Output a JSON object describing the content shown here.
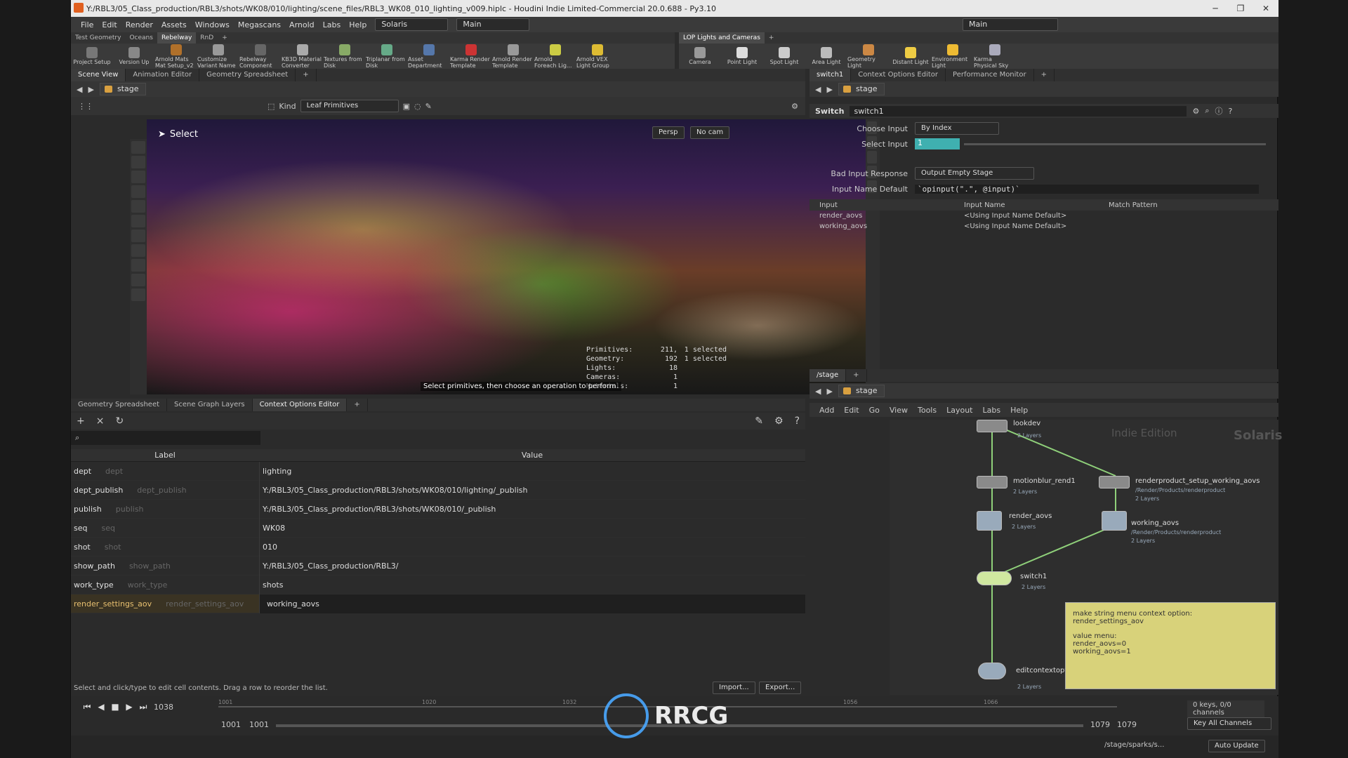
{
  "window": {
    "title": "Y:/RBL3/05_Class_production/RBL3/shots/WK08/010/lighting/scene_files/RBL3_WK08_010_lighting_v009.hiplc - Houdini Indie Limited-Commercial 20.0.688 - Py3.10",
    "minimize": "─",
    "maximize": "❐",
    "close": "✕"
  },
  "menu": [
    "File",
    "Edit",
    "Render",
    "Assets",
    "Windows",
    "Megascans",
    "Arnold",
    "Labs",
    "Help"
  ],
  "desktop": "Solaris",
  "workspace": "Main",
  "workspace_right": "Main",
  "shelf_tabs_left": [
    "Test Geometry",
    "Oceans",
    "Rebelway",
    "RnD"
  ],
  "shelf_tools_left": [
    "Project Setup",
    "Version Up",
    "Arnold Mats Mat Setup_v2",
    "Customize Variant Name",
    "Rebelway Component",
    "KB3D Material Converter",
    "Textures from Disk",
    "Triplanar from Disk",
    "Asset Department",
    "Karma Render Template",
    "Arnold Render Template",
    "Arnold Foreach Lig...",
    "Arnold VEX Light Group"
  ],
  "shelf_tabs_right": [
    "LOP Lights and Cameras"
  ],
  "shelf_tools_right": [
    "Camera",
    "Point Light",
    "Spot Light",
    "Area Light",
    "Geometry Light",
    "Distant Light",
    "Environment Light",
    "Karma Physical Sky"
  ],
  "viewer_tabs": [
    "Scene View",
    "Animation Editor",
    "Geometry Spreadsheet"
  ],
  "stage_path": "stage",
  "viewer": {
    "kind_label": "Kind",
    "kind_value": "Leaf Primitives",
    "select_label": "Select",
    "persp": "Persp",
    "cam": "No cam",
    "hint": "Select primitives, then choose an operation to perform.",
    "stats": [
      {
        "k": "Primitives:",
        "v": "211,",
        "s": "1 selected"
      },
      {
        "k": "Geometry:",
        "v": "192",
        "s": "1 selected"
      },
      {
        "k": "Lights:",
        "v": "18",
        "s": ""
      },
      {
        "k": "Cameras:",
        "v": "1",
        "s": ""
      },
      {
        "k": "Materials:",
        "v": "1",
        "s": ""
      }
    ]
  },
  "bottom_tabs": [
    "Geometry Spreadsheet",
    "Scene Graph Layers",
    "Context Options Editor"
  ],
  "sheet": {
    "col_label": "Label",
    "col_value": "Value",
    "footer": "Select and click/type to edit cell contents. Drag a row to reorder the list.",
    "import": "Import...",
    "export": "Export...",
    "rows": [
      {
        "label": "dept",
        "name": "dept",
        "value": "lighting"
      },
      {
        "label": "dept_publish",
        "name": "dept_publish",
        "value": "Y:/RBL3/05_Class_production/RBL3/shots/WK08/010/lighting/_publish"
      },
      {
        "label": "publish",
        "name": "publish",
        "value": "Y:/RBL3/05_Class_production/RBL3/shots/WK08/010/_publish"
      },
      {
        "label": "seq",
        "name": "seq",
        "value": "WK08"
      },
      {
        "label": "shot",
        "name": "shot",
        "value": "010"
      },
      {
        "label": "show_path",
        "name": "show_path",
        "value": "Y:/RBL3/05_Class_production/RBL3/"
      },
      {
        "label": "work_type",
        "name": "work_type",
        "value": "shots"
      },
      {
        "label": "render_settings_aov",
        "name": "render_settings_aov",
        "value": "working_aovs"
      }
    ]
  },
  "param_tabs": [
    "switch1",
    "Context Options Editor",
    "Performance Monitor"
  ],
  "params": {
    "type": "Switch",
    "name": "switch1",
    "choose_input_label": "Choose Input",
    "choose_input": "By Index",
    "select_input_label": "Select Input",
    "select_input": "1",
    "bad_input_label": "Bad Input Response",
    "bad_input": "Output Empty Stage",
    "input_name_default_label": "Input Name Default",
    "input_name_default": "`opinput(\".\", @input)`",
    "cols": [
      "Input",
      "Input Name",
      "Match Pattern"
    ],
    "inputs": [
      {
        "input": "render_aovs",
        "name": "<Using Input Name Default>"
      },
      {
        "input": "working_aovs",
        "name": "<Using Input Name Default>"
      }
    ]
  },
  "net_tabs": [
    "/stage"
  ],
  "net_menu": [
    "Add",
    "Edit",
    "Go",
    "View",
    "Tools",
    "Layout",
    "Labs",
    "Help"
  ],
  "net": {
    "watermark_left": "Indie Edition",
    "watermark_right": "Solaris",
    "nodes": [
      {
        "name": "lookdev",
        "sub": "2 Layers"
      },
      {
        "name": "motionblur_rend1",
        "sub": "2 Layers"
      },
      {
        "name": "renderproduct_setup_working_aovs",
        "sub": "/Render/Products/renderproduct",
        "sub2": "2 Layers"
      },
      {
        "name": "render_aovs",
        "sub": "2 Layers"
      },
      {
        "name": "working_aovs",
        "sub": "/Render/Products/renderproduct",
        "sub2": "2 Layers"
      },
      {
        "name": "switch1",
        "sub": "2 Layers"
      },
      {
        "name": "editcontextoptions",
        "sub": "2 Layers"
      }
    ],
    "note": [
      "make string menu context option:",
      "render_settings_aov",
      "",
      "value menu:",
      "render_aovs=0",
      "working_aovs=1"
    ]
  },
  "timeline": {
    "frame": "1038",
    "start": "1001",
    "start2": "1001",
    "end": "1079",
    "end2": "1079",
    "keys": "0 keys, 0/0 channels",
    "key_all": "Key All Channels",
    "ticks": [
      "1001",
      "1020",
      "1032",
      "1056",
      "1066"
    ]
  },
  "status": {
    "path": "/stage/sparks/s...",
    "auto": "Auto Update"
  },
  "brand": "RRCG"
}
